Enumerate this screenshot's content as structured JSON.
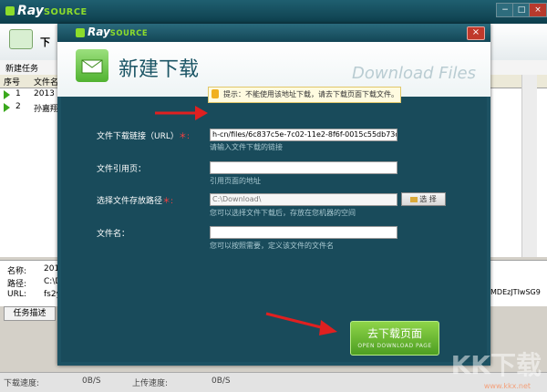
{
  "app": {
    "logo_text": "Ray",
    "logo_suffix": "SOURCE",
    "window_buttons": [
      "−",
      "□",
      "×"
    ]
  },
  "background": {
    "tab_label": "下",
    "menu_item": "新建任务",
    "table_headers": [
      "序号",
      "文件名"
    ],
    "rows": [
      {
        "num": "1",
        "name": "2013 H"
      },
      {
        "num": "2",
        "name": "孙嘉翔"
      }
    ],
    "details": {
      "name_label": "名称:",
      "name_value": "201",
      "path_label": "路径:",
      "path_value": "C:\\D",
      "url_label": "URL:",
      "url_value": "fs2y",
      "right_text": "MDEzJTIwSG9"
    },
    "desc_tab": "任务描述",
    "status": {
      "download_label": "下载速度:",
      "download_value": "0B/S",
      "upload_label": "上传速度:",
      "upload_value": "0B/S"
    }
  },
  "dialog": {
    "logo_text": "Ray",
    "logo_suffix": "SOURCE",
    "close": "×",
    "title": "新建下载",
    "subtitle": "Download Files",
    "tip": "提示：不能使用该地址下载，请去下载页面下载文件。",
    "fields": {
      "url_label": "文件下载链接（URL）",
      "url_value": "h-cn/files/6c837c5e-7c02-11e2-8f6f-0015c55db73d",
      "url_hint": "请输入文件下载的链接",
      "ref_label": "文件引用页：",
      "ref_value": "",
      "ref_hint": "引用页面的地址",
      "path_label": "选择文件存放路径",
      "path_value": "C:\\Download\\",
      "path_hint": "您可以选择文件下载后，存放在您机器的空间",
      "browse_label": "选 择",
      "name_label": "文件名：",
      "name_value": "",
      "name_hint": "您可以按照需要，定义该文件的文件名"
    },
    "go_button": "去下载页面",
    "go_button_sub": "OPEN DOWNLOAD PAGE"
  },
  "watermark": {
    "text": "KK下载",
    "url": "www.kkx.net"
  },
  "colors": {
    "dialog_bg": "#194b5b",
    "accent_green": "#4d9e22",
    "arrow_red": "#e02020"
  }
}
